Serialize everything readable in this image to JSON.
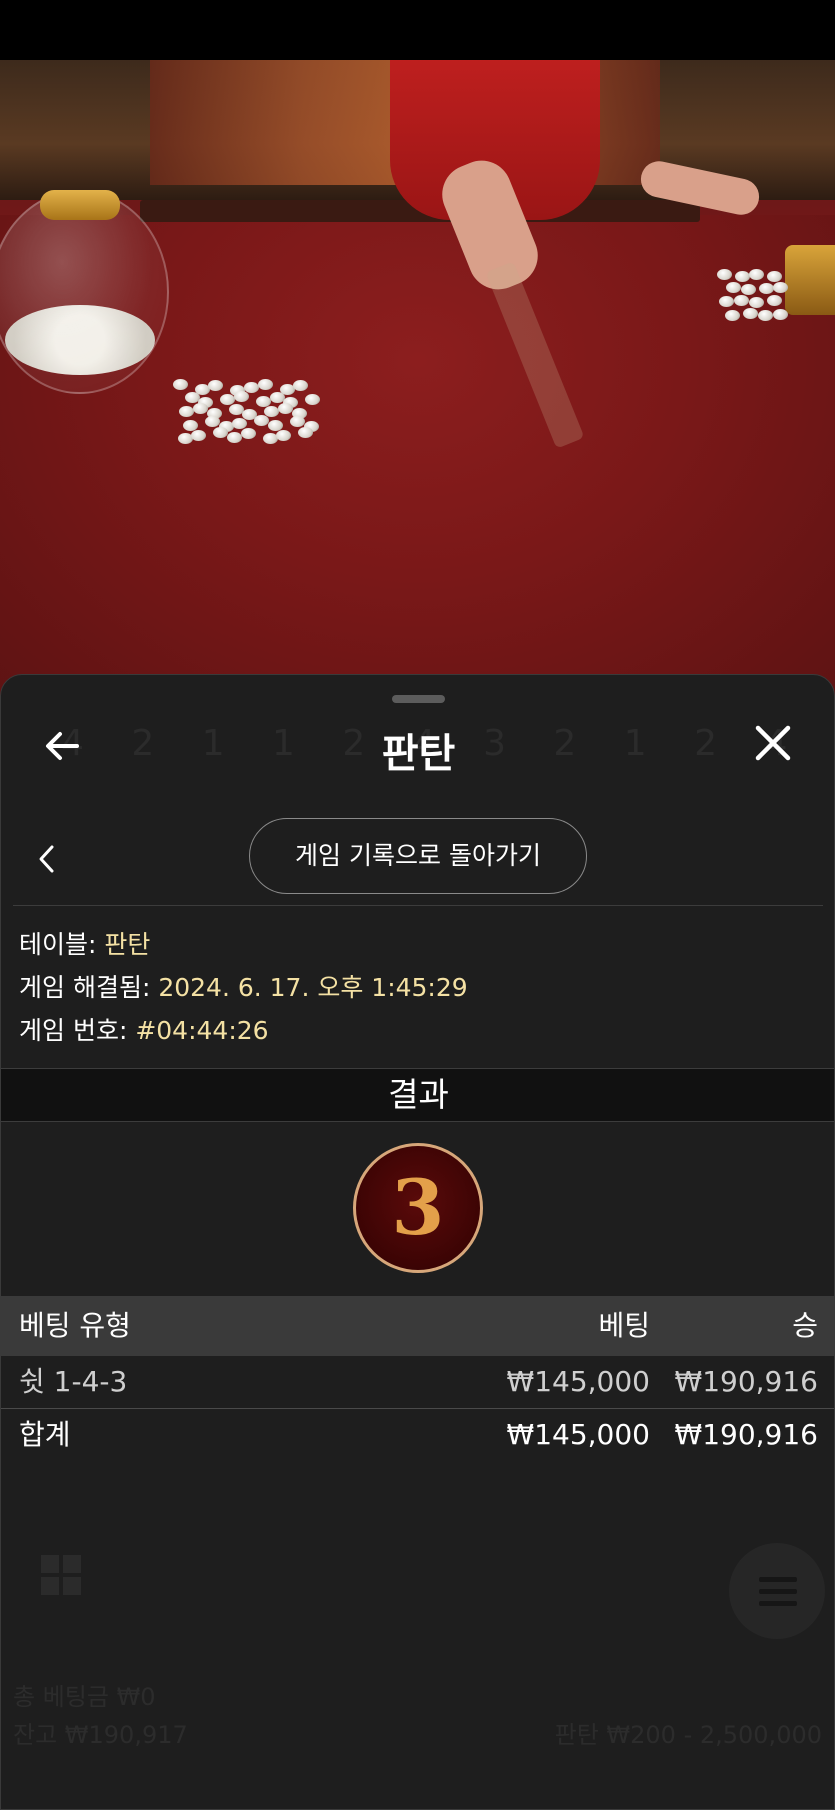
{
  "header": {
    "title": "판탄",
    "back_button": "arrow-left-icon",
    "close_button": "close-icon"
  },
  "nav": {
    "history_button_label": "게임 기록으로 돌아가기"
  },
  "details": {
    "table_label": "테이블: ",
    "table_value": "판탄",
    "resolved_label": "게임 해결됨: ",
    "resolved_value": "2024. 6. 17. 오후 1:45:29",
    "game_no_label": "게임 번호: ",
    "game_no_value": "#04:44:26"
  },
  "result": {
    "label": "결과",
    "value": "3"
  },
  "bets_table": {
    "headers": {
      "type": "베팅 유형",
      "bet": "베팅",
      "win": "승"
    },
    "rows": [
      {
        "type": "쉿 1-4-3",
        "bet": "₩145,000",
        "win": "₩190,916"
      }
    ],
    "total": {
      "label": "합계",
      "bet": "₩145,000",
      "win": "₩190,916"
    }
  },
  "background_overlay": {
    "ghost_digits": "4 2 1 1 2 4 3 2 1 2 4 4",
    "total_bet": "총 베팅금 ₩0",
    "balance": "잔고 ₩190,917",
    "table_limit": "판탄 ₩200 - 2,500,000"
  },
  "colors": {
    "sheet_bg": "#1e1e1e",
    "accent_value": "#f4e1a4",
    "result_ring": "#d7a77a",
    "result_bg": "#3c0404"
  }
}
